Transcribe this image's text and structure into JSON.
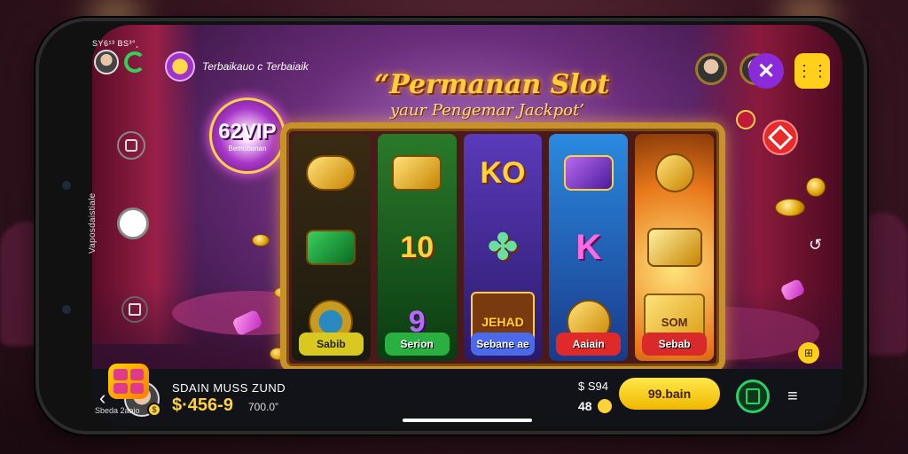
{
  "status": {
    "time": "SY6¹³ BS³°¸"
  },
  "brand": {
    "name": "Terbaikauo c Terbaiaik"
  },
  "title": {
    "line1": "“Permanan Slot",
    "line2": "yaur Pengemar Jackpot’"
  },
  "vip": {
    "label": "62VIP",
    "sub": "Bemobanan"
  },
  "side": {
    "vertical_label": "Vaposdaistiale",
    "app_caption": "Sbeda 2aaio"
  },
  "reels": [
    {
      "color": "#2a2a1a",
      "symbols": [
        "",
        "",
        ""
      ],
      "button": "Sabib",
      "button_color": "#d8c820"
    },
    {
      "color": "#1a6a2a",
      "symbols": [
        "",
        "10",
        "9"
      ],
      "button": "Serion",
      "button_color": "#2ab040"
    },
    {
      "color": "#4a2a9a",
      "symbols": [
        "KO",
        "",
        "JEHAD"
      ],
      "button": "Sebane ae",
      "button_color": "#4a6aea"
    },
    {
      "color": "#2a7ad0",
      "symbols": [
        "",
        "K",
        ""
      ],
      "button": "Aaiain",
      "button_color": "#e02a2a"
    },
    {
      "color": "#e8781a",
      "symbols": [
        "",
        "",
        "SOM"
      ],
      "button": "Sebab",
      "button_color": "#d82a2a"
    }
  ],
  "bottombar": {
    "username": "SDAIN MUSS ZUND",
    "balance": "$·456-9",
    "balance_sub": "700.0”",
    "bet_top": "$ S94",
    "bet_bottom": "48",
    "spin_label": "99.bain"
  }
}
